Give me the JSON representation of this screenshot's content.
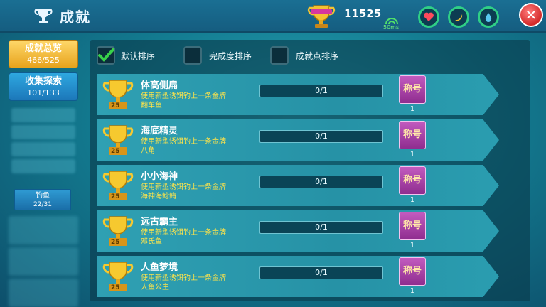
{
  "header": {
    "title": "成就",
    "points": "11525",
    "ping": "50ms"
  },
  "sidebar": {
    "overview_label": "成就总览",
    "overview_count": "466/525",
    "explore_label": "收集探索",
    "explore_count": "101/133",
    "fishing_label": "钓鱼",
    "fishing_count": "22/31"
  },
  "sort_options": [
    {
      "label": "默认排序",
      "checked": true
    },
    {
      "label": "完成度排序",
      "checked": false
    },
    {
      "label": "成就点排序",
      "checked": false
    }
  ],
  "achievements": [
    {
      "name": "体高侧扁",
      "desc_line1": "使用新型诱饵钓上一条金牌",
      "desc_line2": "翻车鱼",
      "trophy_points": "25",
      "progress": "0/1",
      "progress_fraction": 0,
      "reward_label": "称号",
      "reward_count": "1"
    },
    {
      "name": "海底精灵",
      "desc_line1": "使用新型诱饵钓上一条金牌",
      "desc_line2": "八角",
      "trophy_points": "25",
      "progress": "0/1",
      "progress_fraction": 0,
      "reward_label": "称号",
      "reward_count": "1"
    },
    {
      "name": "小小海神",
      "desc_line1": "使用新型诱饵钓上一条金牌",
      "desc_line2": "海神海鲶鲔",
      "trophy_points": "25",
      "progress": "0/1",
      "progress_fraction": 0,
      "reward_label": "称号",
      "reward_count": "1"
    },
    {
      "name": "远古霸主",
      "desc_line1": "使用新型诱饵钓上一条金牌",
      "desc_line2": "邓氏鱼",
      "trophy_points": "25",
      "progress": "0/1",
      "progress_fraction": 0,
      "reward_label": "称号",
      "reward_count": "1"
    },
    {
      "name": "人鱼梦境",
      "desc_line1": "使用新型诱饵钓上一条金牌",
      "desc_line2": "人鱼公主",
      "trophy_points": "25",
      "progress": "0/1",
      "progress_fraction": 0,
      "reward_label": "称号",
      "reward_count": "1"
    }
  ],
  "colors": {
    "accent_gold": "#ffd86a",
    "desc_yellow": "#ffe44a",
    "check_green": "#39d14a",
    "close_red": "#d42a2a"
  },
  "icons": {
    "title": "trophy-icon",
    "points": "trophy-cup-icon",
    "status": [
      "heart-icon",
      "banana-icon",
      "water-drop-icon"
    ],
    "close": "close-icon"
  }
}
